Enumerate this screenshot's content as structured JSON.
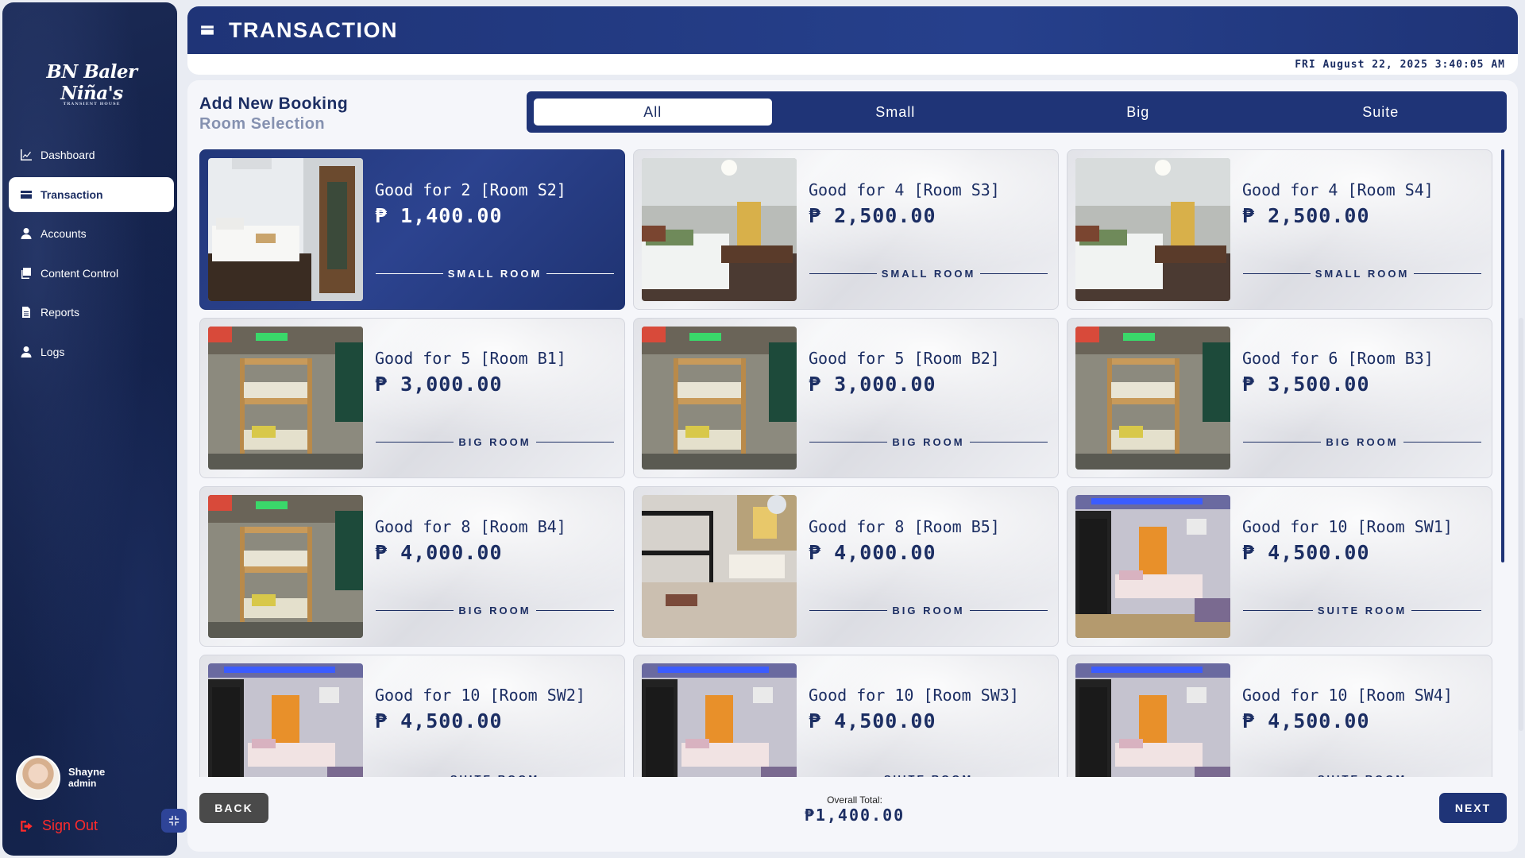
{
  "brand": {
    "logo_text": "BN Baler Niña's",
    "logo_sub": "TRANSIENT HOUSE"
  },
  "sidebar": {
    "items": [
      {
        "label": "Dashboard",
        "icon": "chart-line-icon"
      },
      {
        "label": "Transaction",
        "icon": "credit-card-icon",
        "active": true
      },
      {
        "label": "Accounts",
        "icon": "user-icon"
      },
      {
        "label": "Content Control",
        "icon": "copy-icon"
      },
      {
        "label": "Reports",
        "icon": "file-icon"
      },
      {
        "label": "Logs",
        "icon": "user-icon"
      }
    ],
    "user": {
      "name": "Shayne",
      "role": "admin"
    },
    "signout_label": "Sign Out"
  },
  "header": {
    "title": "TRANSACTION",
    "datetime": "FRI August 22, 2025 3:40:05 AM"
  },
  "main": {
    "heading": "Add New Booking",
    "subheading": "Room Selection",
    "tabs": [
      {
        "label": "All",
        "active": true
      },
      {
        "label": "Small"
      },
      {
        "label": "Big"
      },
      {
        "label": "Suite"
      }
    ],
    "rooms": [
      {
        "title": "Good for 2 [Room S2]",
        "price": "₱ 1,400.00",
        "type": "SMALL ROOM",
        "selected": true,
        "photo": "small-white"
      },
      {
        "title": "Good for 4 [Room S3]",
        "price": "₱ 2,500.00",
        "type": "SMALL ROOM",
        "photo": "small-dark"
      },
      {
        "title": "Good for 4 [Room S4]",
        "price": "₱ 2,500.00",
        "type": "SMALL ROOM",
        "photo": "small-dark"
      },
      {
        "title": "Good for 5 [Room B1]",
        "price": "₱ 3,000.00",
        "type": "BIG ROOM",
        "photo": "bunk-wood"
      },
      {
        "title": "Good for 5 [Room B2]",
        "price": "₱ 3,000.00",
        "type": "BIG ROOM",
        "photo": "bunk-wood"
      },
      {
        "title": "Good for 6 [Room B3]",
        "price": "₱ 3,500.00",
        "type": "BIG ROOM",
        "photo": "bunk-wood"
      },
      {
        "title": "Good for 8 [Room B4]",
        "price": "₱ 4,000.00",
        "type": "BIG ROOM",
        "photo": "bunk-wood"
      },
      {
        "title": "Good for 8 [Room B5]",
        "price": "₱ 4,000.00",
        "type": "BIG ROOM",
        "photo": "bunk-black"
      },
      {
        "title": "Good for 10 [Room SW1]",
        "price": "₱ 4,500.00",
        "type": "SUITE ROOM",
        "photo": "suite"
      },
      {
        "title": "Good for 10 [Room SW2]",
        "price": "₱ 4,500.00",
        "type": "SUITE ROOM",
        "photo": "suite"
      },
      {
        "title": "Good for 10 [Room SW3]",
        "price": "₱ 4,500.00",
        "type": "SUITE ROOM",
        "photo": "suite"
      },
      {
        "title": "Good for 10 [Room SW4]",
        "price": "₱ 4,500.00",
        "type": "SUITE ROOM",
        "photo": "suite"
      }
    ],
    "total_label": "Overall Total:",
    "total_value": "₱1,400.00",
    "back_label": "BACK",
    "next_label": "NEXT"
  },
  "colors": {
    "primary": "#1f3477",
    "text_dark": "#1c2e63",
    "signout": "#ff2b2b",
    "back_button": "#4a4a4a"
  }
}
